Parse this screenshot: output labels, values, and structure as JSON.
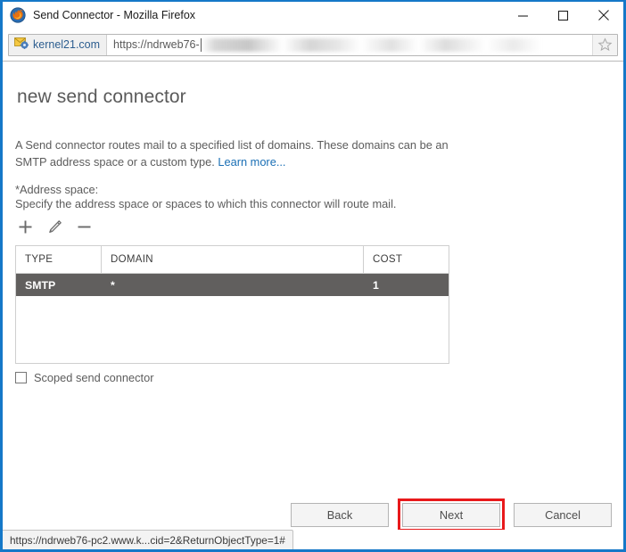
{
  "window": {
    "title": "Send Connector - Mozilla Firefox",
    "app_icon": "firefox-logo-icon",
    "controls": {
      "minimize": "minimize-icon",
      "maximize": "maximize-icon",
      "close": "close-icon"
    },
    "frame_color": "#1578c8"
  },
  "navbar": {
    "identity_label": "kernel21.com",
    "identity_icon": "envelope-gear-favicon",
    "url_visible": "https://ndrweb76-",
    "url_placeholder": "Search or enter address",
    "bookmark_icon": "star-icon"
  },
  "page": {
    "title": "new send connector",
    "intro_text": "A Send connector routes mail to a specified list of domains. These domains can be an SMTP address space or a custom type.",
    "learn_more": "Learn more...",
    "address_space_label": "*Address space:",
    "address_space_desc": "Specify the address space or spaces to which this connector will route mail.",
    "toolbar": [
      {
        "name": "add-icon",
        "glyph": "+"
      },
      {
        "name": "edit-pencil-icon",
        "glyph": "pencil"
      },
      {
        "name": "remove-icon",
        "glyph": "-"
      }
    ],
    "grid": {
      "columns": [
        "TYPE",
        "DOMAIN",
        "COST"
      ],
      "rows": [
        {
          "type": "SMTP",
          "domain": "*",
          "cost": "1",
          "selected": true
        }
      ],
      "selected_row_color": "#615f5e"
    },
    "scoped": {
      "label": "Scoped send connector",
      "checked": false
    }
  },
  "footer": {
    "back_label": "Back",
    "next_label": "Next",
    "cancel_label": "Cancel",
    "highlight_color": "#e8191b",
    "highlighted_button": "Next"
  },
  "statusbar": {
    "url": "https://ndrweb76-pc2.www.k...cid=2&ReturnObjectType=1#"
  }
}
